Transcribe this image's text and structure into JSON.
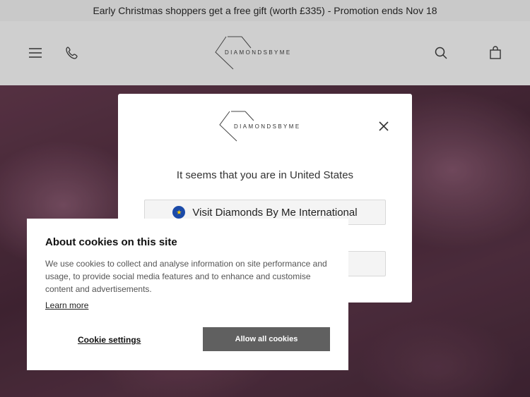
{
  "promo": {
    "text": "Early Christmas shoppers get a free gift (worth £335) - Promotion ends Nov 18"
  },
  "header": {
    "logo_text": "DIAMONDSBYME",
    "icons": [
      "menu-icon",
      "phone-icon",
      "search-icon",
      "bag-icon"
    ]
  },
  "modal": {
    "logo_text": "DIAMONDSBYME",
    "message": "It seems that you are in United States",
    "visit_button": "Visit Diamonds By Me International",
    "second_button": "",
    "flag_icon": "eu-flag-icon"
  },
  "cookie": {
    "title": "About cookies on this site",
    "body": "We use cookies to collect and analyse information on site performance and usage, to provide social media features and to enhance and customise content and advertisements.",
    "learn_more": "Learn more",
    "settings_label": "Cookie settings",
    "allow_label": "Allow all cookies"
  },
  "colors": {
    "allow_button": "#606060",
    "header_bg": "#cfcfcf",
    "promo_bg": "#c9c9c9"
  }
}
